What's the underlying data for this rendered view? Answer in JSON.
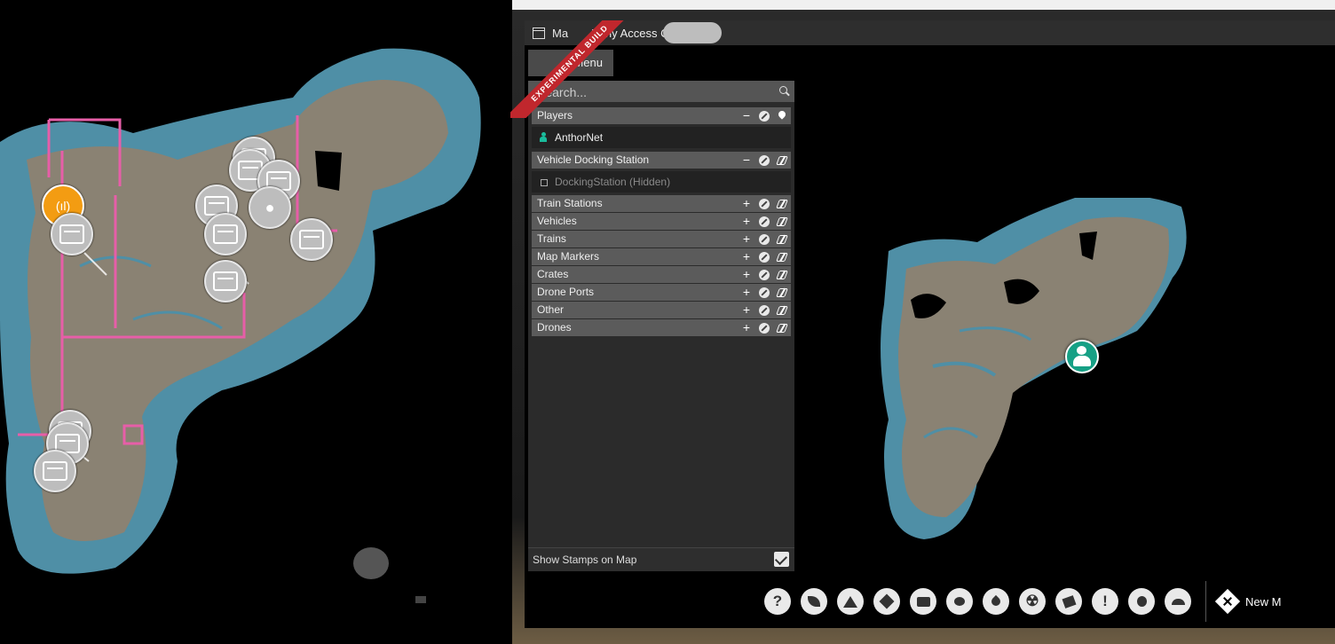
{
  "window": {
    "title": "Ma",
    "build_label": "Early Access C",
    "banner": "EXPERIMENTAL BUILD",
    "menu_label": "Menu"
  },
  "search": {
    "placeholder": "Search..."
  },
  "groups": {
    "players": {
      "label": "Players",
      "entries": [
        {
          "label": "AnthorNet",
          "icon": "person-icon"
        }
      ]
    },
    "docking": {
      "label": "Vehicle Docking Station",
      "entries": [
        {
          "label": "DockingStation (Hidden)",
          "icon": "docking-icon"
        }
      ]
    },
    "collapsed": [
      {
        "label": "Train Stations"
      },
      {
        "label": "Vehicles"
      },
      {
        "label": "Trains"
      },
      {
        "label": "Map Markers"
      },
      {
        "label": "Crates"
      },
      {
        "label": "Drone Ports"
      },
      {
        "label": "Other"
      },
      {
        "label": "Drones"
      }
    ],
    "expand_symbol": "+",
    "collapse_symbol": "−"
  },
  "stamps": {
    "label": "Show Stamps on Map",
    "checked": true
  },
  "toolbar": {
    "buttons": [
      {
        "name": "help-icon",
        "glyph": "?"
      },
      {
        "name": "leaf-icon",
        "glyph": ""
      },
      {
        "name": "tent-icon",
        "glyph": ""
      },
      {
        "name": "explosion-icon",
        "glyph": ""
      },
      {
        "name": "crate-icon",
        "glyph": ""
      },
      {
        "name": "paw-icon",
        "glyph": ""
      },
      {
        "name": "water-drop-icon",
        "glyph": ""
      },
      {
        "name": "radiation-icon",
        "glyph": "☢"
      },
      {
        "name": "slug-icon",
        "glyph": ""
      },
      {
        "name": "warning-icon",
        "glyph": "!"
      },
      {
        "name": "bag-icon",
        "glyph": ""
      },
      {
        "name": "creature-icon",
        "glyph": ""
      }
    ],
    "new_marker_label": "New M"
  },
  "colors": {
    "land": "#8a8273",
    "shallow_water": "#4f8fa6",
    "deep_water": "#2b5d70",
    "player_marker": "#16a085",
    "banner_red": "#c0272d",
    "accent_orange": "#f39c12",
    "belt_pink": "#e75ea8"
  }
}
